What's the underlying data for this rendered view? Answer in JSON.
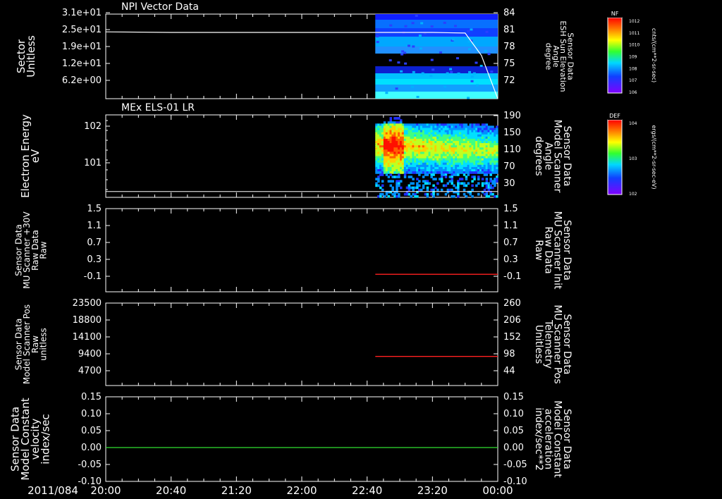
{
  "chart_data": [
    {
      "type": "heatmap",
      "title": "NPI Vector Data",
      "ylabel_left": [
        "Sector",
        "Unitless"
      ],
      "yticks_left": [
        "3.1e+01",
        "2.5e+01",
        "1.9e+01",
        "1.2e+01",
        "6.2e+00"
      ],
      "ylabel_right": [
        "Sensor Data",
        "ESH Sun Elevation",
        "Angle",
        "degree"
      ],
      "yticks_right": [
        "84",
        "81",
        "78",
        "75",
        "72"
      ],
      "colorbar": {
        "label": "NF",
        "unit": "cnts/(cm**2-sr-sec)",
        "ticks": [
          "10^12",
          "10^11",
          "10^10",
          "10^9",
          "10^8",
          "10^7",
          "10^6"
        ]
      },
      "line_series": {
        "name": "ESH Sun Elevation Angle",
        "x": [
          "20:00",
          "20:40",
          "21:20",
          "22:00",
          "22:40",
          "23:20",
          "23:40",
          "23:50",
          "00:00"
        ],
        "values": [
          81.0,
          80.9,
          80.9,
          80.9,
          80.9,
          80.9,
          80.8,
          77.0,
          69.7
        ]
      },
      "data_start": "22:45"
    },
    {
      "type": "heatmap",
      "title": "MEx ELS-01 LR",
      "ylabel_left": [
        "Electron Energy",
        "eV"
      ],
      "yticks_left": [
        "10^2",
        "10^1"
      ],
      "ylabel_right": [
        "Sensor Data",
        "Model Scanner",
        "Angle",
        "degrees"
      ],
      "yticks_right": [
        "190",
        "150",
        "110",
        "70",
        "30"
      ],
      "colorbar": {
        "label": "DEF",
        "unit": "ergs/(cm**2-sr-sec-eV)",
        "ticks": [
          "10^4",
          "10^3",
          "10^2"
        ]
      },
      "line_series": {
        "name": "Model Scanner Angle",
        "x": [
          "20:00",
          "00:00"
        ],
        "values": [
          10,
          10
        ]
      },
      "data_start": "22:45"
    },
    {
      "type": "line",
      "ylabel_left": [
        "Sensor Data",
        "MU Scanner +30V",
        "Raw Data",
        "Raw"
      ],
      "yticks_left": [
        "1.5",
        "1.1",
        "0.7",
        "0.3",
        "-0.1"
      ],
      "ylabel_right": [
        "Sensor Data",
        "MU Scanner Init",
        "Raw Data",
        "Raw"
      ],
      "yticks_right": [
        "1.5",
        "1.1",
        "0.7",
        "0.3",
        "-0.1"
      ],
      "ylim": [
        -0.4,
        1.5
      ],
      "series": [
        {
          "name": "MU Scanner Init",
          "color": "#ff2020",
          "x": [
            "22:45",
            "00:00"
          ],
          "values": [
            0.0,
            0.0
          ]
        }
      ]
    },
    {
      "type": "line",
      "ylabel_left": [
        "Sensor Data",
        "Model Scanner Pos",
        "Raw",
        "unitless"
      ],
      "yticks_left": [
        "23500",
        "18800",
        "14100",
        "9400",
        "4700"
      ],
      "ylabel_right": [
        "Sensor Data",
        "MU Scanner Pos",
        "Telemetry",
        "Unitless"
      ],
      "yticks_right": [
        "260",
        "206",
        "152",
        "98",
        "44"
      ],
      "ylim": [
        0,
        23500
      ],
      "series": [
        {
          "name": "MU Scanner Pos Telemetry",
          "color": "#ff2020",
          "x": [
            "22:45",
            "00:00"
          ],
          "values": [
            8300,
            8300
          ]
        }
      ]
    },
    {
      "type": "line",
      "ylabel_left": [
        "Sensor Data",
        "Model Constant",
        "velocity",
        "index/sec"
      ],
      "yticks_left": [
        "0.15",
        "0.10",
        "0.05",
        "0.00",
        "-0.05",
        "-0.10"
      ],
      "ylabel_right": [
        "Sensor Data",
        "Model Constant",
        "acceleration",
        "index/sec**2"
      ],
      "yticks_right": [
        "0.15",
        "0.10",
        "0.05",
        "0.00",
        "-0.05",
        "-0.10"
      ],
      "ylim": [
        -0.1,
        0.15
      ],
      "series": [
        {
          "name": "Model Constant",
          "color": "#30e030",
          "x": [
            "20:00",
            "00:00"
          ],
          "values": [
            0.0,
            0.0
          ]
        }
      ]
    }
  ],
  "x_axis": {
    "date_label": "2011/084",
    "ticks": [
      "20:00",
      "20:40",
      "21:20",
      "22:00",
      "22:40",
      "23:20",
      "00:00"
    ]
  },
  "colors": {
    "background": "#000000",
    "axes": "#ffffff",
    "right_label_p3": "#ff2020",
    "right_label_p4": "#ff2020",
    "right_label_p5": "#30e030"
  }
}
